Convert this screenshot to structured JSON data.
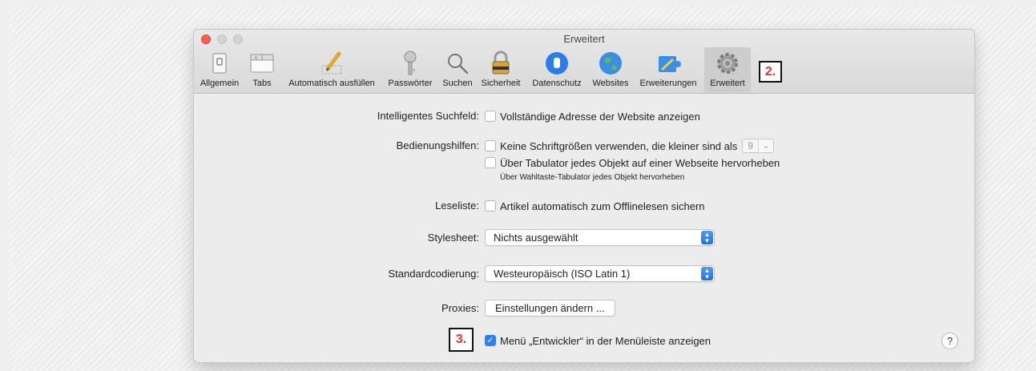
{
  "window": {
    "title": "Erweitert"
  },
  "toolbar": {
    "items": [
      {
        "label": "Allgemein",
        "icon": "switch-icon"
      },
      {
        "label": "Tabs",
        "icon": "tabs-icon"
      },
      {
        "label": "Automatisch ausfüllen",
        "icon": "pencil-icon"
      },
      {
        "label": "Passwörter",
        "icon": "key-icon"
      },
      {
        "label": "Suchen",
        "icon": "magnifier-icon"
      },
      {
        "label": "Sicherheit",
        "icon": "padlock-icon"
      },
      {
        "label": "Datenschutz",
        "icon": "hand-icon"
      },
      {
        "label": "Websites",
        "icon": "globe-icon"
      },
      {
        "label": "Erweiterungen",
        "icon": "puzzle-icon"
      },
      {
        "label": "Erweitert",
        "icon": "gear-icon",
        "selected": true
      }
    ]
  },
  "annotations": {
    "step2": "2.",
    "step3": "3.",
    "color": "#e8322e"
  },
  "settings": {
    "smart_search": {
      "label": "Intelligentes Suchfeld:",
      "option": "Vollständige Adresse der Website anzeigen",
      "checked": false
    },
    "accessibility": {
      "label": "Bedienungshilfen:",
      "option1": "Keine Schriftgrößen verwenden, die kleiner sind als",
      "font_size": "9",
      "option2": "Über Tabulator jedes Objekt auf einer Webseite hervorheben",
      "hint": "Über Wahltaste-Tabulator jedes Objekt hervorheben"
    },
    "reading_list": {
      "label": "Leseliste:",
      "option": "Artikel automatisch zum Offlinelesen sichern",
      "checked": false
    },
    "stylesheet": {
      "label": "Stylesheet:",
      "value": "Nichts ausgewählt"
    },
    "encoding": {
      "label": "Standardcodierung:",
      "value": "Westeuropäisch (ISO Latin 1)"
    },
    "proxies": {
      "label": "Proxies:",
      "button": "Einstellungen ändern ..."
    },
    "developer_menu": {
      "option": "Menü „Entwickler“ in der Menüleiste anzeigen",
      "checked": true
    },
    "help": "?"
  },
  "colors": {
    "accent": "#2f7ff5",
    "close_button": "#fd5f57"
  }
}
